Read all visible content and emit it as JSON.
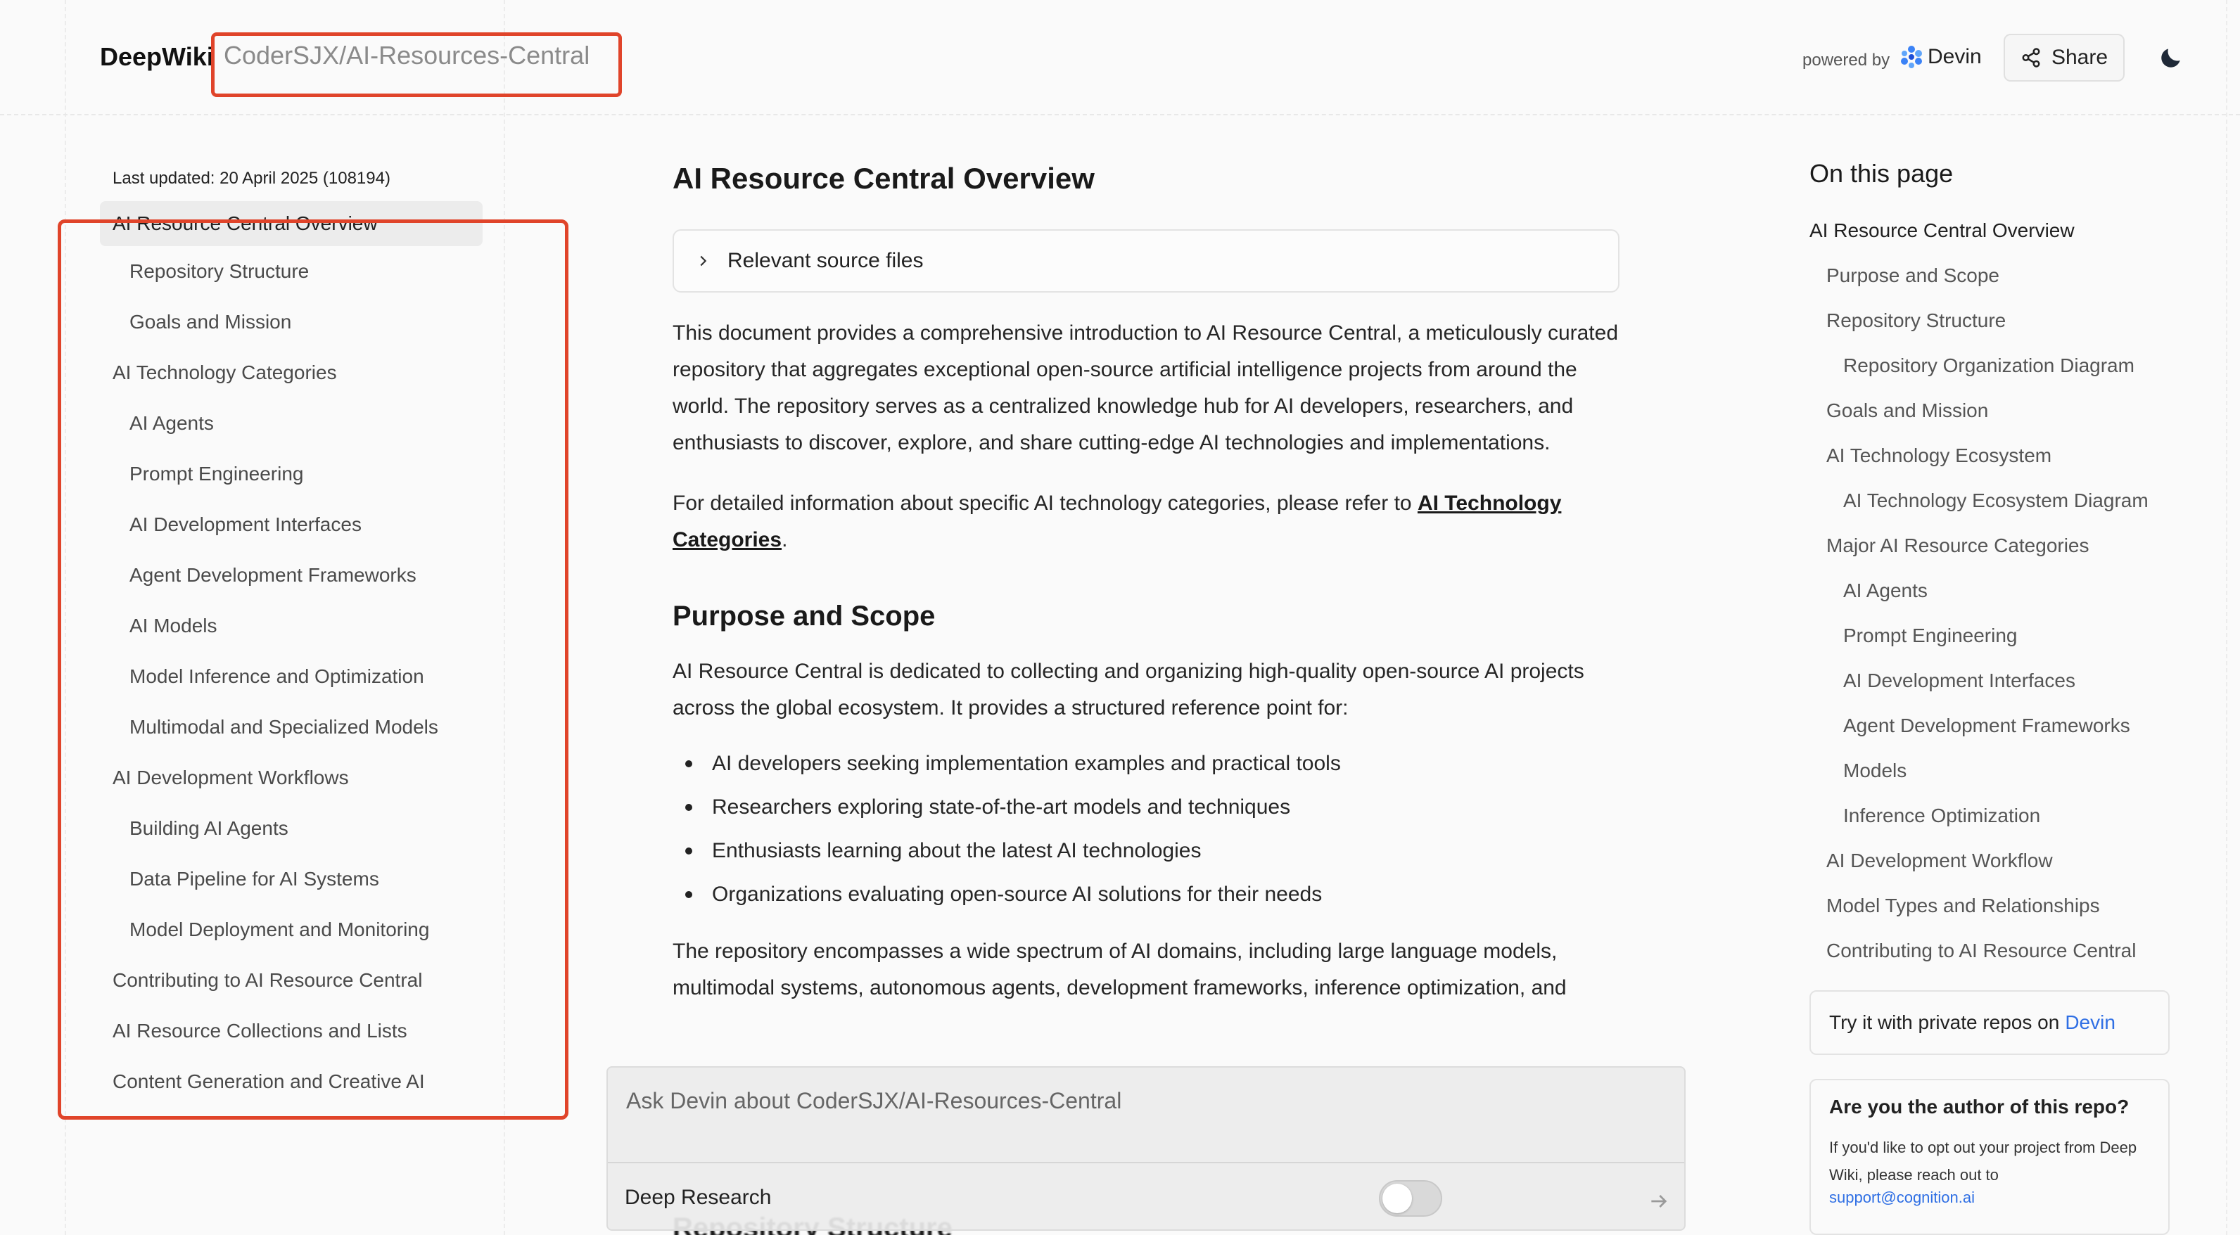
{
  "header": {
    "logo": "DeepWiki",
    "repo": "CoderSJX/AI-Resources-Central",
    "powered_by": "powered by",
    "devin": "Devin",
    "share_label": "Share"
  },
  "sidebar": {
    "last_updated": "Last updated: 20 April 2025 (108194)",
    "items": [
      {
        "label": "AI Resource Central Overview",
        "level": 1,
        "active": true
      },
      {
        "label": "Repository Structure",
        "level": 2
      },
      {
        "label": "Goals and Mission",
        "level": 2
      },
      {
        "label": "AI Technology Categories",
        "level": 1
      },
      {
        "label": "AI Agents",
        "level": 2
      },
      {
        "label": "Prompt Engineering",
        "level": 2
      },
      {
        "label": "AI Development Interfaces",
        "level": 2
      },
      {
        "label": "Agent Development Frameworks",
        "level": 2
      },
      {
        "label": "AI Models",
        "level": 2
      },
      {
        "label": "Model Inference and Optimization",
        "level": 2
      },
      {
        "label": "Multimodal and Specialized Models",
        "level": 2
      },
      {
        "label": "AI Development Workflows",
        "level": 1
      },
      {
        "label": "Building AI Agents",
        "level": 2
      },
      {
        "label": "Data Pipeline for AI Systems",
        "level": 2
      },
      {
        "label": "Model Deployment and Monitoring",
        "level": 2
      },
      {
        "label": "Contributing to AI Resource Central",
        "level": 1
      },
      {
        "label": "AI Resource Collections and Lists",
        "level": 1
      },
      {
        "label": "Content Generation and Creative AI",
        "level": 1
      }
    ]
  },
  "main": {
    "title": "AI Resource Central Overview",
    "sources_label": "Relevant source files",
    "intro": "This document provides a comprehensive introduction to AI Resource Central, a meticulously curated repository that aggregates exceptional open-source artificial intelligence projects from around the world. The repository serves as a centralized knowledge hub for AI developers, researchers, and enthusiasts to discover, explore, and share cutting-edge AI technologies and implementations.",
    "detail_prefix": "For detailed information about specific AI technology categories, please refer to ",
    "detail_link": "AI Technology Categories",
    "detail_suffix": ".",
    "section_title": "Purpose and Scope",
    "purpose": "AI Resource Central is dedicated to collecting and organizing high-quality open-source AI projects across the global ecosystem. It provides a structured reference point for:",
    "bullets": [
      "AI developers seeking implementation examples and practical tools",
      "Researchers exploring state-of-the-art models and techniques",
      "Enthusiasts learning about the latest AI technologies",
      "Organizations evaluating open-source AI solutions for their needs"
    ],
    "spectrum": "The repository encompasses a wide spectrum of AI domains, including large language models, multimodal systems, autonomous agents, development frameworks, inference optimization, and",
    "next_heading": "Repository Structure"
  },
  "ask": {
    "placeholder": "Ask Devin about CoderSJX/AI-Resources-Central",
    "deep_research": "Deep Research",
    "deep_research_on": false
  },
  "toc": {
    "title": "On this page",
    "items": [
      {
        "label": "AI Resource Central Overview",
        "level": 1
      },
      {
        "label": "Purpose and Scope",
        "level": 2
      },
      {
        "label": "Repository Structure",
        "level": 2
      },
      {
        "label": "Repository Organization Diagram",
        "level": 3
      },
      {
        "label": "Goals and Mission",
        "level": 2
      },
      {
        "label": "AI Technology Ecosystem",
        "level": 2
      },
      {
        "label": "AI Technology Ecosystem Diagram",
        "level": 3
      },
      {
        "label": "Major AI Resource Categories",
        "level": 2
      },
      {
        "label": "AI Agents",
        "level": 3
      },
      {
        "label": "Prompt Engineering",
        "level": 3
      },
      {
        "label": "AI Development Interfaces",
        "level": 3
      },
      {
        "label": "Agent Development Frameworks",
        "level": 3
      },
      {
        "label": "Models",
        "level": 3
      },
      {
        "label": "Inference Optimization",
        "level": 3
      },
      {
        "label": "AI Development Workflow",
        "level": 2
      },
      {
        "label": "Model Types and Relationships",
        "level": 2
      },
      {
        "label": "Contributing to AI Resource Central",
        "level": 2
      }
    ]
  },
  "cards": {
    "private_prefix": "Try it with private repos on",
    "private_link": "Devin",
    "author_title": "Are you the author of this repo?",
    "author_body": "If you'd like to opt out your project from Deep Wiki, please reach out to",
    "author_email": "support@cognition.ai"
  },
  "colors": {
    "highlight": "#e0442a",
    "link": "#2f6fe4",
    "devin_logo": "#3b82f6"
  }
}
